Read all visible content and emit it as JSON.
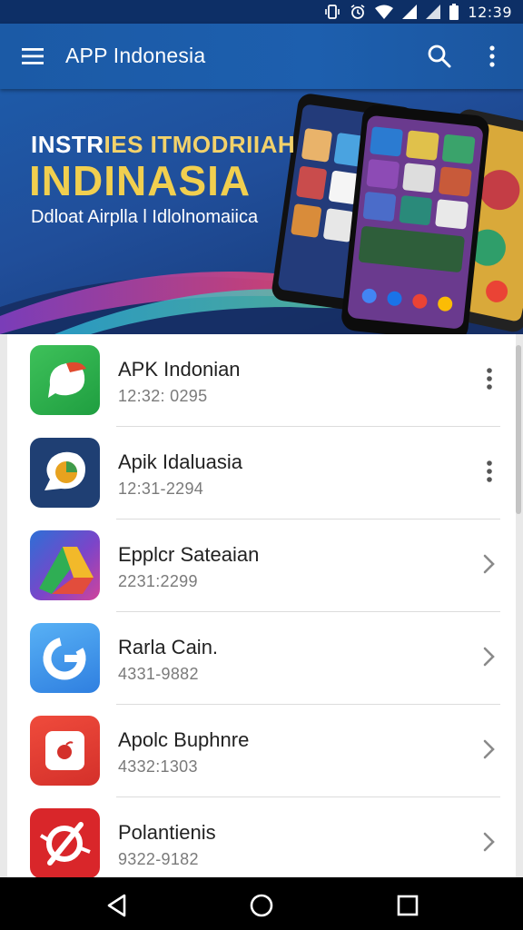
{
  "status_bar": {
    "time": "12:39",
    "icons": [
      "vibrate-icon",
      "alarm-icon",
      "wifi-icon",
      "signal-icon",
      "signal-icon",
      "battery-icon"
    ]
  },
  "app_bar": {
    "title": "APP Indonesia",
    "menu_icon": "hamburger-menu-icon",
    "search_icon": "search-icon",
    "more_icon": "more-vertical-icon"
  },
  "banner": {
    "line1_part1": "INSTR",
    "line1_part2": "IES ITMODRIIAH",
    "line2": "INDINASIA",
    "line3": "Ddloat Airplla l Idlolnomaiica"
  },
  "apps": [
    {
      "name": "APK Indonian",
      "sub": "12:32: 0295",
      "action": "more",
      "icon": "messenger-app-icon"
    },
    {
      "name": "Apik Idaluasia",
      "sub": "12:31-2294",
      "action": "more",
      "icon": "chat-app-icon"
    },
    {
      "name": "Epplcr Sateaian",
      "sub": "2231:2299",
      "action": "chevron",
      "icon": "drive-app-icon"
    },
    {
      "name": "Rarla Cain.",
      "sub": "4331-9882",
      "action": "chevron",
      "icon": "g-app-icon"
    },
    {
      "name": "Apolc Buphnre",
      "sub": "4332:1303",
      "action": "chevron",
      "icon": "camera-app-icon"
    },
    {
      "name": "Polantienis",
      "sub": "9322-9182",
      "action": "chevron",
      "icon": "no-symbol-app-icon"
    }
  ],
  "nav_bar": {
    "back_icon": "back-triangle-icon",
    "home_icon": "home-circle-icon",
    "recents_icon": "recents-square-icon"
  },
  "colors": {
    "status_bar": "#0d2f66",
    "app_bar": "#1d5fae",
    "banner_yellow": "#f1cf4f"
  }
}
